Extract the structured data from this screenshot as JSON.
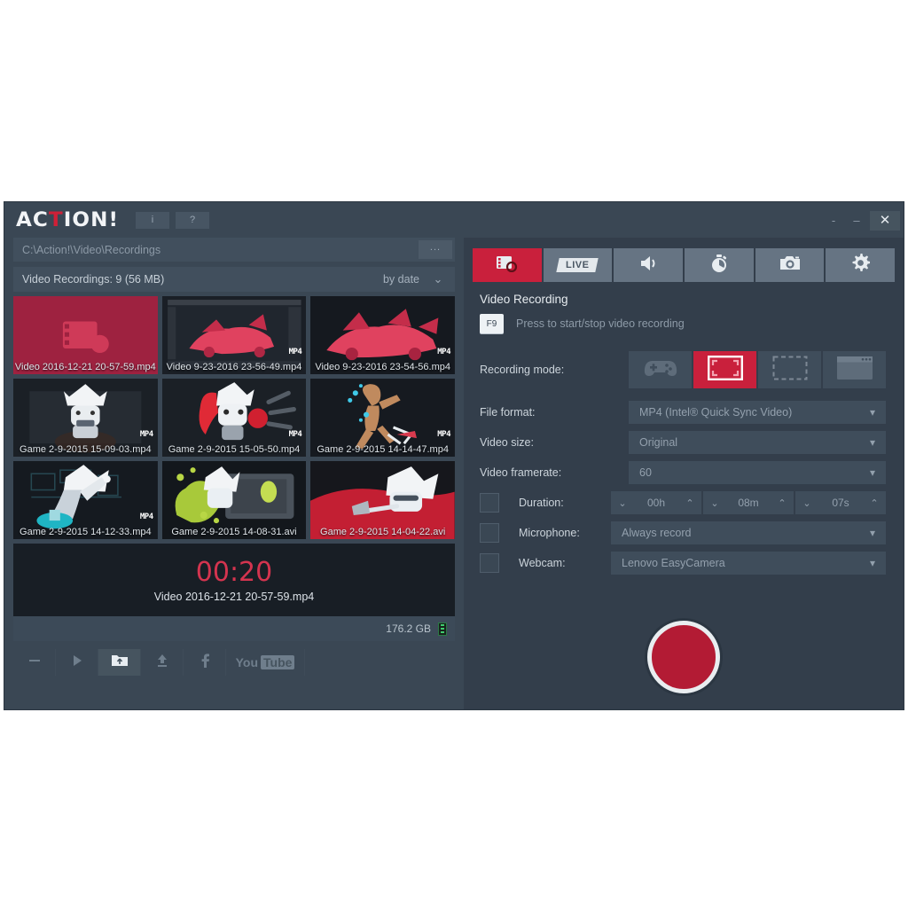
{
  "app": {
    "logo_prefix": "AC",
    "logo_t": "T",
    "logo_suffix": "ION!",
    "info_button": "i",
    "help_button": "?",
    "minimize_small": "-",
    "minimize": "–",
    "close": "✕"
  },
  "left": {
    "path": "C:\\Action!\\Video\\Recordings",
    "path_placeholder": "C:\\Action!\\Video\\Recordings",
    "browse_label": "...",
    "recordings_title": "Video Recordings: 9 (56 MB)",
    "sort_label": "by date",
    "sort_chevron": "⌄",
    "items": [
      {
        "name": "Video 2016-12-21 20-57-59.mp4",
        "badge": "",
        "selected": true,
        "art": "record-placeholder"
      },
      {
        "name": "Video 9-23-2016 23-56-49.mp4",
        "badge": "MP4",
        "selected": false,
        "art": "car-editor"
      },
      {
        "name": "Video 9-23-2016 23-54-56.mp4",
        "badge": "MP4",
        "selected": false,
        "art": "car-red"
      },
      {
        "name": "Game 2-9-2015 15-09-03.mp4",
        "badge": "MP4",
        "selected": false,
        "art": "char-sitting"
      },
      {
        "name": "Game 2-9-2015 15-05-50.mp4",
        "badge": "MP4",
        "selected": false,
        "art": "char-boxing"
      },
      {
        "name": "Game 2-9-2015 14-14-47.mp4",
        "badge": "MP4",
        "selected": false,
        "art": "char-running"
      },
      {
        "name": "Game 2-9-2015 14-12-33.mp4",
        "badge": "MP4",
        "selected": false,
        "art": "char-lab"
      },
      {
        "name": "Game 2-9-2015 14-08-31.avi",
        "badge": "",
        "selected": false,
        "art": "char-slime"
      },
      {
        "name": "Game 2-9-2015 14-04-22.avi",
        "badge": "",
        "selected": false,
        "art": "char-red"
      }
    ],
    "preview": {
      "timer": "00:20",
      "filename": "Video 2016-12-21 20-57-59.mp4"
    },
    "disk_free": "176.2 GB",
    "toolbar": [
      {
        "name": "delete-button",
        "icon": "minus",
        "label": "—",
        "active": false
      },
      {
        "name": "play-button",
        "icon": "play",
        "label": "▶",
        "active": false
      },
      {
        "name": "open-folder-button",
        "icon": "folder-up",
        "label": "",
        "active": true
      },
      {
        "name": "upload-button",
        "icon": "upload",
        "label": "",
        "active": false
      },
      {
        "name": "facebook-button",
        "icon": "facebook",
        "label": "f",
        "active": false
      },
      {
        "name": "youtube-button",
        "icon": "youtube",
        "label": "You",
        "label2": "Tube",
        "active": false
      }
    ]
  },
  "right": {
    "tabs": [
      {
        "id": "video-recording",
        "icon": "video-record-icon",
        "label": "",
        "active": true
      },
      {
        "id": "live-streaming",
        "icon": "live-icon",
        "label": "LIVE",
        "active": false
      },
      {
        "id": "audio",
        "icon": "speaker-icon",
        "label": "",
        "active": false
      },
      {
        "id": "benchmark",
        "icon": "stopwatch-icon",
        "label": "",
        "active": false
      },
      {
        "id": "screenshot",
        "icon": "camera-icon",
        "label": "",
        "active": false
      },
      {
        "id": "settings",
        "icon": "gear-icon",
        "label": "",
        "active": false
      }
    ],
    "section_title": "Video Recording",
    "hotkey": "F9",
    "hotkey_hint": "Press to start/stop video recording",
    "recording_mode_label": "Recording mode:",
    "modes": [
      {
        "id": "games-apps",
        "icon": "gamepad-icon",
        "active": false
      },
      {
        "id": "active-screen",
        "icon": "fullscreen-icon",
        "active": true
      },
      {
        "id": "screen-region",
        "icon": "region-icon",
        "active": false
      },
      {
        "id": "application-window",
        "icon": "window-icon",
        "active": false
      }
    ],
    "fields": [
      {
        "id": "file-format",
        "label": "File format:",
        "value": "MP4 (Intel® Quick Sync Video)",
        "checkbox": false
      },
      {
        "id": "video-size",
        "label": "Video size:",
        "value": "Original",
        "checkbox": false
      },
      {
        "id": "video-framerate",
        "label": "Video framerate:",
        "value": "60",
        "checkbox": false
      }
    ],
    "duration": {
      "label": "Duration:",
      "checkbox": false,
      "hours": "00h",
      "minutes": "08m",
      "seconds": "07s",
      "down_arrow": "⌄",
      "up_arrow": "⌃"
    },
    "microphone": {
      "label": "Microphone:",
      "value": "Always record",
      "checkbox": false
    },
    "webcam": {
      "label": "Webcam:",
      "value": "Lenovo EasyCamera",
      "checkbox": false
    },
    "record_button": "record"
  },
  "colors": {
    "accent_red": "#c9203c",
    "window_bg": "#3a4754",
    "panel_bg": "#333e4b",
    "field_bg": "#3f4d5b",
    "text": "#ccd4db",
    "muted": "#8e9ba8"
  }
}
